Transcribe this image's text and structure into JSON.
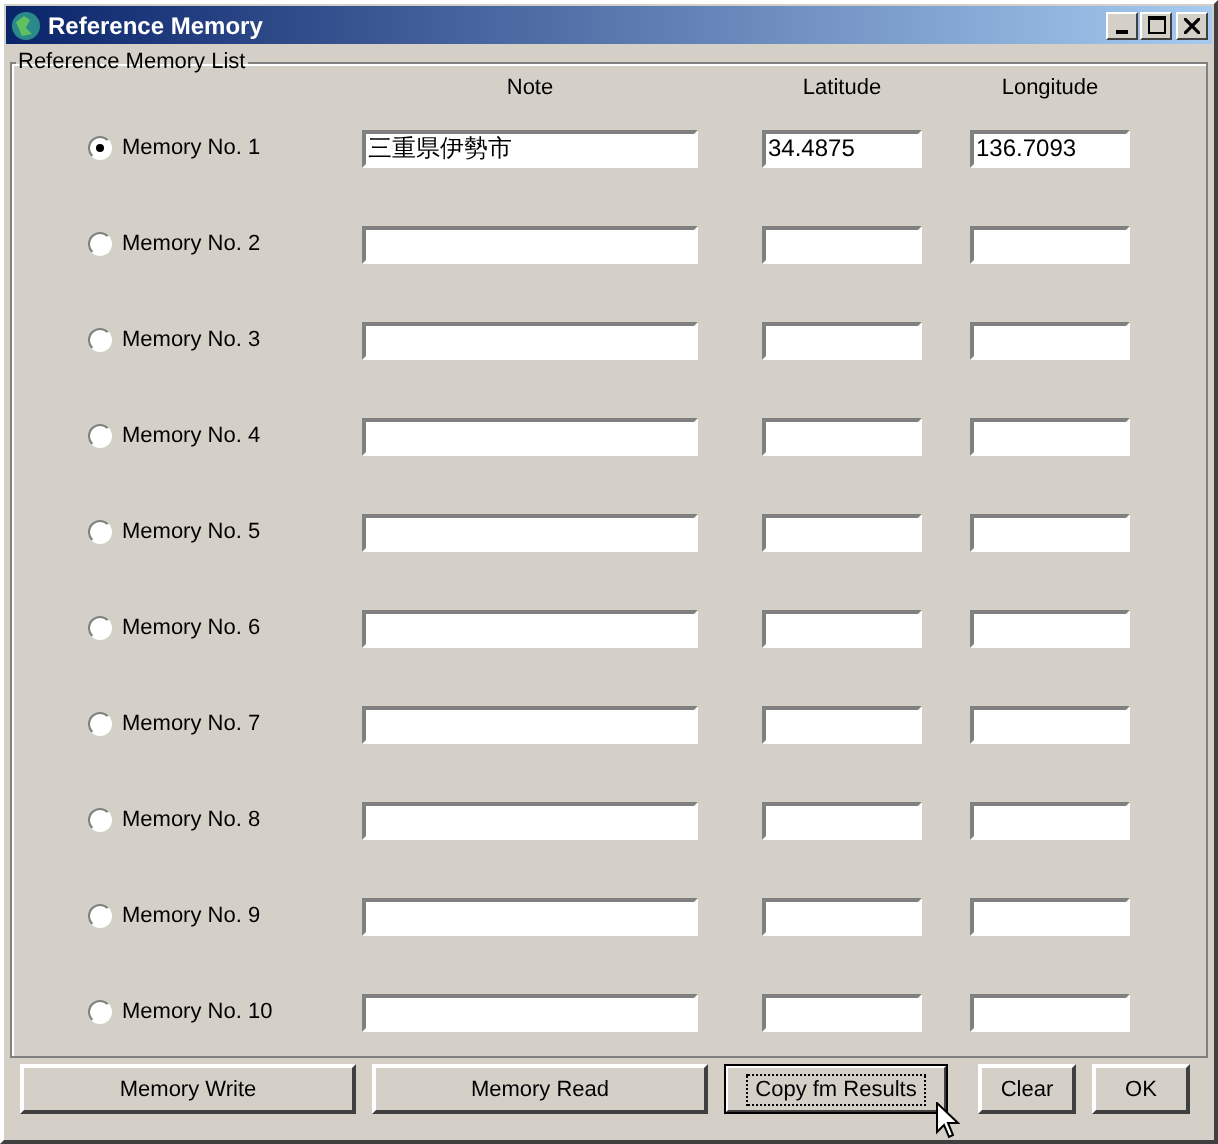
{
  "window": {
    "title": "Reference Memory"
  },
  "group": {
    "label": "Reference Memory List"
  },
  "columns": [
    "Note",
    "Latitude",
    "Longitude"
  ],
  "memories": [
    {
      "label": "Memory No. 1",
      "selected": true,
      "note": "三重県伊勢市",
      "latitude": "34.4875",
      "longitude": "136.7093"
    },
    {
      "label": "Memory No. 2",
      "selected": false
    },
    {
      "label": "Memory No. 3",
      "selected": false
    },
    {
      "label": "Memory No. 4",
      "selected": false
    },
    {
      "label": "Memory No. 5",
      "selected": false
    },
    {
      "label": "Memory No. 6",
      "selected": false
    },
    {
      "label": "Memory No. 7",
      "selected": false
    },
    {
      "label": "Memory No. 8",
      "selected": false
    },
    {
      "label": "Memory No. 9",
      "selected": false
    },
    {
      "label": "Memory No. 10",
      "selected": false
    }
  ],
  "buttons": [
    {
      "label": "Memory Write",
      "focused": false
    },
    {
      "label": "Memory Read",
      "focused": false
    },
    {
      "label": "Copy fm Results",
      "focused": true
    },
    {
      "label": "Clear",
      "focused": false
    },
    {
      "label": "OK",
      "focused": false
    }
  ]
}
